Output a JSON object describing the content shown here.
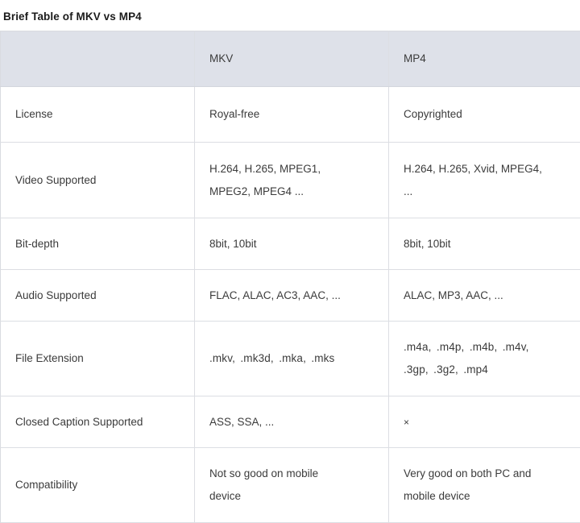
{
  "title": "Brief Table of MKV vs MP4",
  "colors": {
    "header_bg": "#dee1e9",
    "border": "#dcdee3",
    "text": "#3b3b3b",
    "title_text": "#1b1b1b",
    "page_bg": "#ffffff"
  },
  "table": {
    "headers": [
      "",
      "MKV",
      "MP4"
    ],
    "rows": [
      {
        "label": "License",
        "mkv": "Royal-free",
        "mp4": "Copyrighted"
      },
      {
        "label": "Video Supported",
        "mkv_line1": "H.264, H.265, MPEG1,",
        "mkv_line2": "MPEG2, MPEG4 ...",
        "mp4_line1": "H.264, H.265, Xvid, MPEG4,",
        "mp4_line2": "..."
      },
      {
        "label": "Bit-depth",
        "mkv": "8bit, 10bit",
        "mp4": "8bit, 10bit"
      },
      {
        "label": "Audio Supported",
        "mkv": "FLAC, ALAC, AC3, AAC, ...",
        "mp4": "ALAC, MP3, AAC, ..."
      },
      {
        "label": "File Extension",
        "mkv": ".mkv, .mk3d, .mka, .mks",
        "mp4_line1": ".m4a, .m4p, .m4b, .m4v,",
        "mp4_line2": ".3gp, .3g2, .mp4"
      },
      {
        "label": "Closed Caption Supported",
        "mkv": "ASS, SSA, ...",
        "mp4": "×"
      },
      {
        "label": "Compatibility",
        "mkv_line1": "Not so good on mobile",
        "mkv_line2": "device",
        "mp4_line1": "Very good on both PC and",
        "mp4_line2": "mobile device"
      }
    ]
  }
}
